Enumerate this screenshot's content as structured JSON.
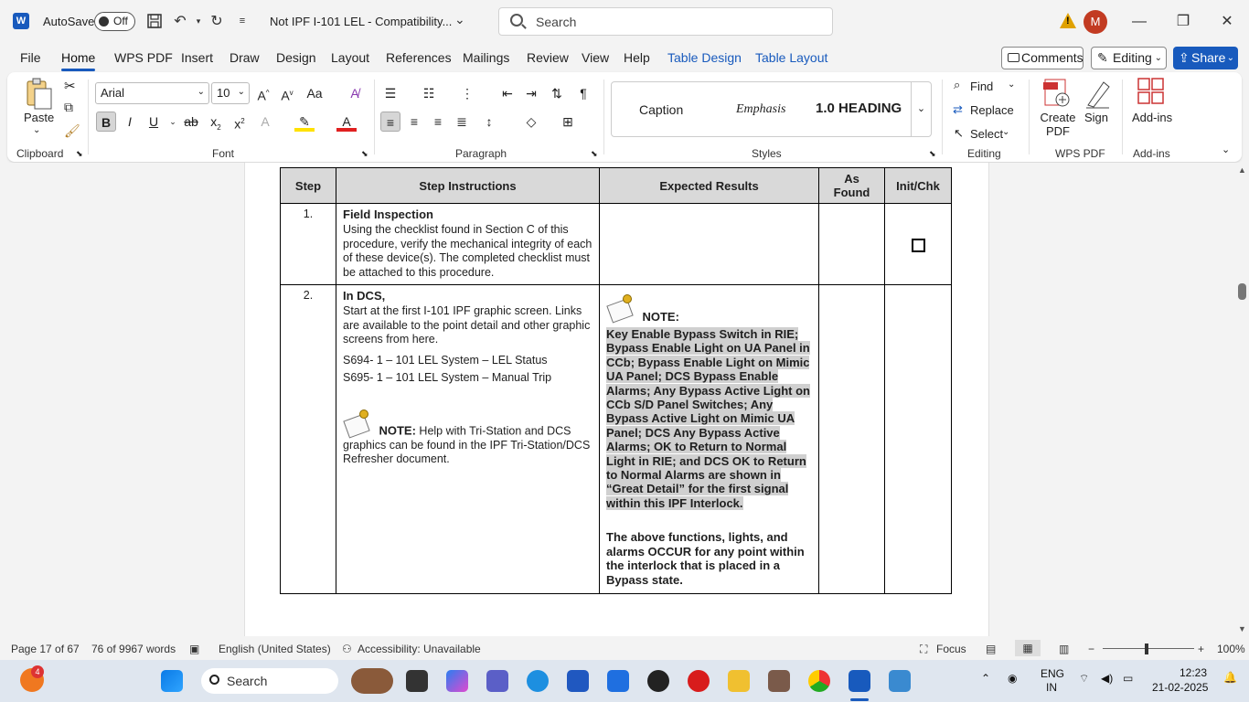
{
  "titlebar": {
    "autosave_label": "AutoSave",
    "autosave_state": "Off",
    "doc_title": "Not IPF I-101 LEL  -  Compatibility...",
    "search_placeholder": "Search",
    "avatar_initial": "M"
  },
  "tabs": [
    "File",
    "Home",
    "WPS PDF",
    "Insert",
    "Draw",
    "Design",
    "Layout",
    "References",
    "Mailings",
    "Review",
    "View",
    "Help",
    "Table Design",
    "Table Layout"
  ],
  "actions": {
    "comments": "Comments",
    "editing": "Editing",
    "share": "Share"
  },
  "ribbon": {
    "clipboard": {
      "paste": "Paste",
      "label": "Clipboard"
    },
    "font": {
      "name": "Arial",
      "size": "10",
      "label": "Font",
      "bold": "B",
      "italic": "I",
      "underline": "U"
    },
    "paragraph": {
      "label": "Paragraph"
    },
    "styles": {
      "items": [
        "Caption",
        "Emphasis",
        "1.0  HEADING"
      ],
      "label": "Styles"
    },
    "editing": {
      "find": "Find",
      "replace": "Replace",
      "select": "Select",
      "label": "Editing"
    },
    "wps": {
      "create_pdf": "Create PDF",
      "sign": "Sign",
      "label": "WPS PDF"
    },
    "addins": {
      "addins": "Add-ins",
      "label": "Add-ins"
    }
  },
  "table": {
    "headers": [
      "Step",
      "Step Instructions",
      "Expected Results",
      "As Found",
      "Init/Chk"
    ],
    "row1": {
      "step": "1.",
      "title": "Field Inspection",
      "text": "Using the checklist found in Section C of this procedure, verify the mechanical integrity of each of these device(s). The completed checklist must be attached to this procedure."
    },
    "row2": {
      "step": "2.",
      "title": "In DCS,",
      "text": "Start at the first I-101 IPF graphic screen. Links are available to the point detail and other graphic screens from here.",
      "line1": "S694- 1 – 101 LEL System – LEL Status",
      "line2": "S695- 1 – 101 LEL System – Manual Trip",
      "note_label": "NOTE:",
      "note_text": "Help with Tri-Station and DCS graphics can be found in the IPF Tri-Station/DCS Refresher document.",
      "expected_note_label": "NOTE:",
      "expected_highlight": "Key Enable Bypass Switch in RIE; Bypass Enable Light on UA Panel in CCb; Bypass Enable Light on Mimic UA Panel; DCS Bypass Enable Alarms; Any Bypass Active Light on CCb S/D Panel Switches; Any Bypass Active Light on Mimic UA Panel; DCS Any Bypass Active Alarms; OK to Return to Normal Light in RIE; and DCS OK to Return to Normal Alarms are shown in “Great Detail” for the first signal within this IPF Interlock.",
      "expected_text": "The above functions, lights, and alarms OCCUR for any point within the interlock that is placed in a Bypass state."
    }
  },
  "statusbar": {
    "page": "Page 17 of 67",
    "words": "76 of 9967 words",
    "language": "English (United States)",
    "accessibility": "Accessibility: Unavailable",
    "focus": "Focus",
    "zoom": "100%"
  },
  "taskbar": {
    "search": "Search",
    "badge": "4",
    "lang1": "ENG",
    "lang2": "IN",
    "time": "12:23",
    "date": "21-02-2025"
  },
  "colors": {
    "accent": "#185abd",
    "highlight": "#d0d0d0"
  }
}
